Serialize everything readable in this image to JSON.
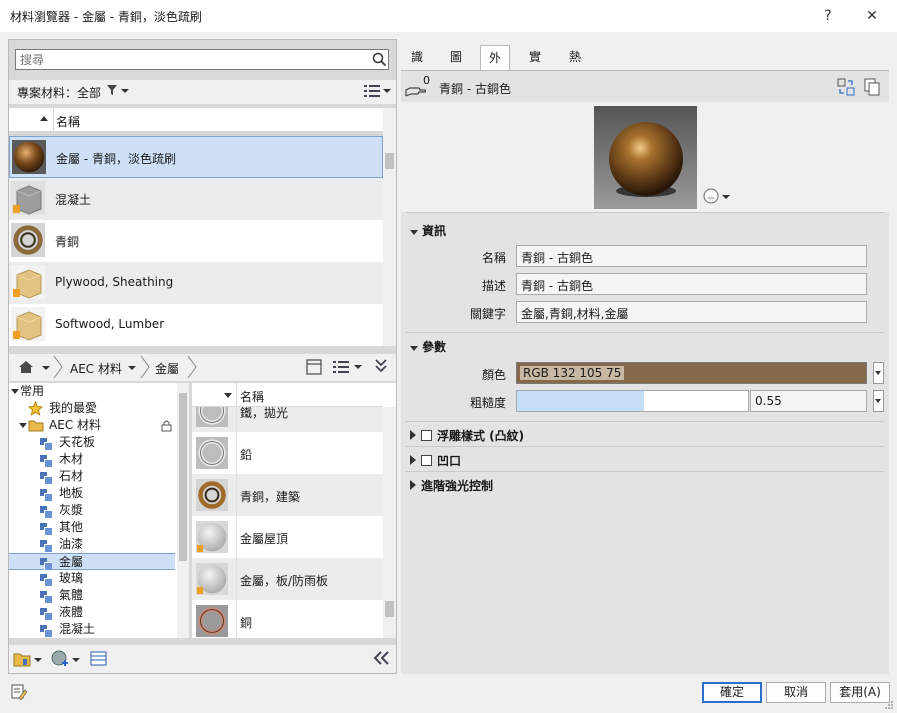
{
  "window": {
    "title": "材料瀏覽器 - 金屬 - 青銅，淡色疏刷",
    "help": "?",
    "close": "✕"
  },
  "search": {
    "placeholder": "搜尋"
  },
  "filter": {
    "label": "專案材料：全部"
  },
  "list": {
    "header": "名稱",
    "items": [
      {
        "label": "金屬 - 青銅，淡色疏刷",
        "kind": "bronze"
      },
      {
        "label": "混凝土",
        "kind": "concrete"
      },
      {
        "label": "青銅",
        "kind": "ring"
      },
      {
        "label": "Plywood, Sheathing",
        "kind": "wood"
      },
      {
        "label": "Softwood, Lumber",
        "kind": "wood"
      }
    ]
  },
  "breadcrumb": {
    "items": [
      "AEC 材料",
      "金屬"
    ]
  },
  "tree": {
    "items": [
      {
        "label": "常用",
        "level": 0,
        "icon": "expand"
      },
      {
        "label": "我的最愛",
        "level": 1,
        "icon": "star"
      },
      {
        "label": "AEC 材料",
        "level": 1,
        "icon": "folder"
      },
      {
        "label": "天花板",
        "level": 2,
        "icon": "cat"
      },
      {
        "label": "木材",
        "level": 2,
        "icon": "cat"
      },
      {
        "label": "石材",
        "level": 2,
        "icon": "cat"
      },
      {
        "label": "地板",
        "level": 2,
        "icon": "cat"
      },
      {
        "label": "灰漿",
        "level": 2,
        "icon": "cat"
      },
      {
        "label": "其他",
        "level": 2,
        "icon": "cat"
      },
      {
        "label": "油漆",
        "level": 2,
        "icon": "cat"
      },
      {
        "label": "金屬",
        "level": 2,
        "icon": "cat",
        "selected": true
      },
      {
        "label": "玻璃",
        "level": 2,
        "icon": "cat"
      },
      {
        "label": "氣體",
        "level": 2,
        "icon": "cat"
      },
      {
        "label": "液體",
        "level": 2,
        "icon": "cat"
      },
      {
        "label": "混凝土",
        "level": 2,
        "icon": "cat"
      }
    ]
  },
  "library": {
    "header": "名稱",
    "items": [
      {
        "label": "鐵，拋光",
        "kind": "chrome"
      },
      {
        "label": "鉛",
        "kind": "chrome"
      },
      {
        "label": "青銅，建築",
        "kind": "bronzering"
      },
      {
        "label": "金屬屋頂",
        "kind": "matte"
      },
      {
        "label": "金屬，板/防雨板",
        "kind": "matte"
      },
      {
        "label": "銅",
        "kind": "copper"
      }
    ]
  },
  "tabs": [
    "識別",
    "圖形",
    "外觀",
    "實體",
    "熱度"
  ],
  "active_tab": "外觀",
  "asset": {
    "count": "0",
    "name": "青銅 - 古銅色"
  },
  "sections": {
    "info": "資訊",
    "params": "參數",
    "relief": "浮雕樣式 (凸紋)",
    "cutout": "凹口",
    "advanced": "進階強光控制"
  },
  "info": {
    "name_label": "名稱",
    "name_value": "青銅 - 古銅色",
    "desc_label": "描述",
    "desc_value": "青銅 - 古銅色",
    "kw_label": "關鍵字",
    "kw_value": "金屬,青銅,材料,金屬"
  },
  "params": {
    "color_label": "顏色",
    "color_value": "RGB 132 105 75",
    "color_hex": "#84694b",
    "rough_label": "粗糙度",
    "rough_value": "0.55",
    "rough_fraction": 0.55
  },
  "footer": {
    "ok": "確定",
    "cancel": "取消",
    "apply": "套用(A)"
  }
}
